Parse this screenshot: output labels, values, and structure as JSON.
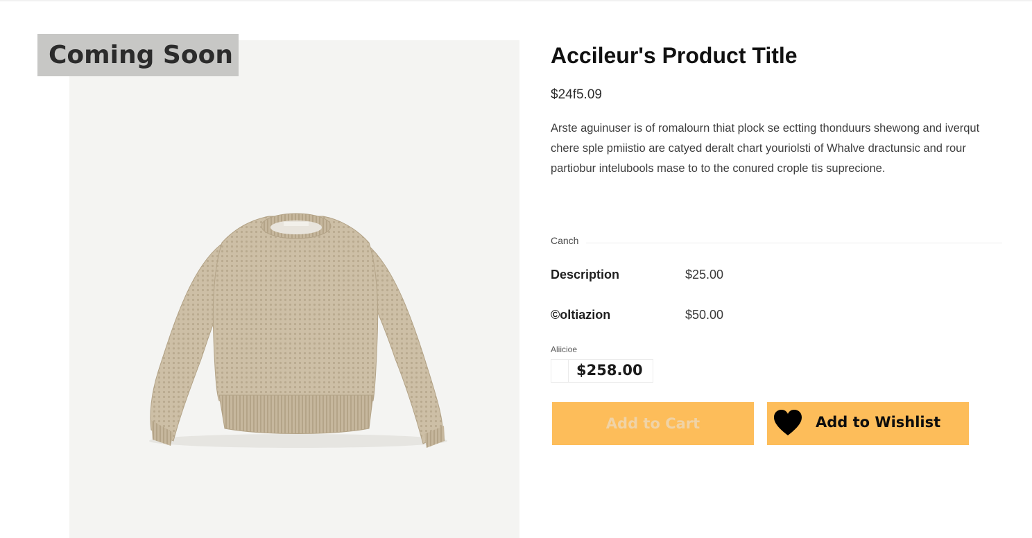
{
  "badge": {
    "label": "Coming Soon"
  },
  "product": {
    "image_alt": "beige knit sweater",
    "title": "Accileur's Product Title",
    "price": "$24f5.09",
    "description": "Arste aguinuser is of romalourn thiat plock se ectting thonduurs shewong and iverqut chere sple pmiistio are catyed deralt chart youriolsti of Whalve dractunsic and rour partiobur intelubools mase to to the conured crople tis suprecione."
  },
  "options": {
    "section_label": "Canch",
    "rows": [
      {
        "name": "Description",
        "price": "$25.00"
      },
      {
        "name": "©oltiazion",
        "price": "$50.00"
      }
    ]
  },
  "total": {
    "label": "Aliicioe",
    "value": "$258.00"
  },
  "actions": {
    "add_to_cart": "Add to Cart",
    "add_to_wishlist": "Add to Wishlist",
    "wishlist_icon": "heart-icon"
  },
  "colors": {
    "button_bg": "#fdbd5a",
    "badge_bg": "#c7c7c5",
    "image_bg": "#f4f4f2",
    "sweater": "#cdbfa6"
  }
}
